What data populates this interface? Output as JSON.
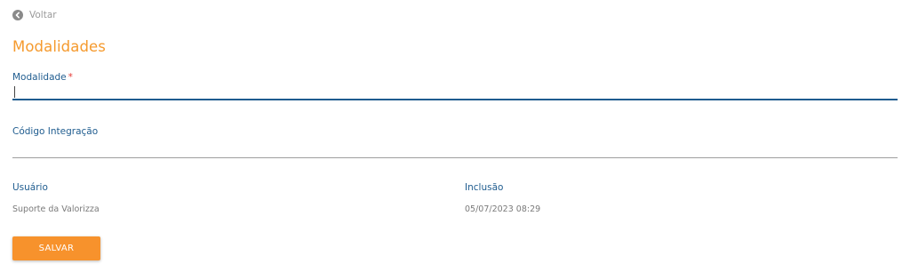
{
  "back": {
    "label": "Voltar",
    "icon": "arrow-left-circle-icon"
  },
  "page_title": "Modalidades",
  "form": {
    "modalidade": {
      "label": "Modalidade",
      "required_mark": "*",
      "value": "",
      "placeholder": ""
    },
    "codigo_integracao": {
      "label": "Código Integração",
      "value": "",
      "placeholder": ""
    }
  },
  "info": {
    "usuario_label": "Usuário",
    "usuario_value": "Suporte da Valorizza",
    "inclusao_label": "Inclusão",
    "inclusao_value": "05/07/2023 08:29"
  },
  "actions": {
    "save_label": "SALVAR"
  },
  "colors": {
    "accent": "#f7922c",
    "title": "#f59a2e",
    "label": "#1f5c8f",
    "required": "#e53935"
  }
}
